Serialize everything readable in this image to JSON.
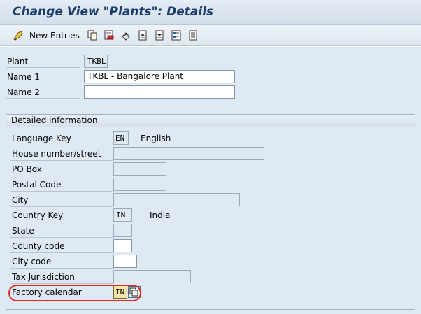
{
  "window": {
    "title": "Change View \"Plants\": Details"
  },
  "toolbar": {
    "new_entries_label": "New Entries",
    "icons": [
      "glasses-icon",
      "copy-icon",
      "delete-icon",
      "undo-icon",
      "previous-entry-icon",
      "next-entry-icon",
      "select-all-icon",
      "variable-list-icon"
    ]
  },
  "form": {
    "plant": {
      "label": "Plant",
      "value": "TKBL"
    },
    "name1": {
      "label": "Name 1",
      "value": "TKBL - Bangalore Plant"
    },
    "name2": {
      "label": "Name 2",
      "value": ""
    }
  },
  "detailed": {
    "header": "Detailed information",
    "language_key": {
      "label": "Language Key",
      "value": "EN",
      "text": "English"
    },
    "house_number": {
      "label": "House number/street",
      "value": ""
    },
    "po_box": {
      "label": "PO Box",
      "value": ""
    },
    "postal_code": {
      "label": "Postal Code",
      "value": ""
    },
    "city": {
      "label": "City",
      "value": ""
    },
    "country_key": {
      "label": "Country Key",
      "value": "IN",
      "text": "India"
    },
    "state": {
      "label": "State",
      "value": ""
    },
    "county_code": {
      "label": "County code",
      "value": ""
    },
    "city_code": {
      "label": "City code",
      "value": ""
    },
    "tax_jurisdiction": {
      "label": "Tax Jurisdiction",
      "value": ""
    },
    "factory_calendar": {
      "label": "Factory calendar",
      "value": "IN"
    }
  },
  "colors": {
    "title_text": "#1c3c6b",
    "panel_bg": "#dfe9f4",
    "highlight_ring": "#e02a1e",
    "focused_field_bg": "#f5e3a6"
  }
}
